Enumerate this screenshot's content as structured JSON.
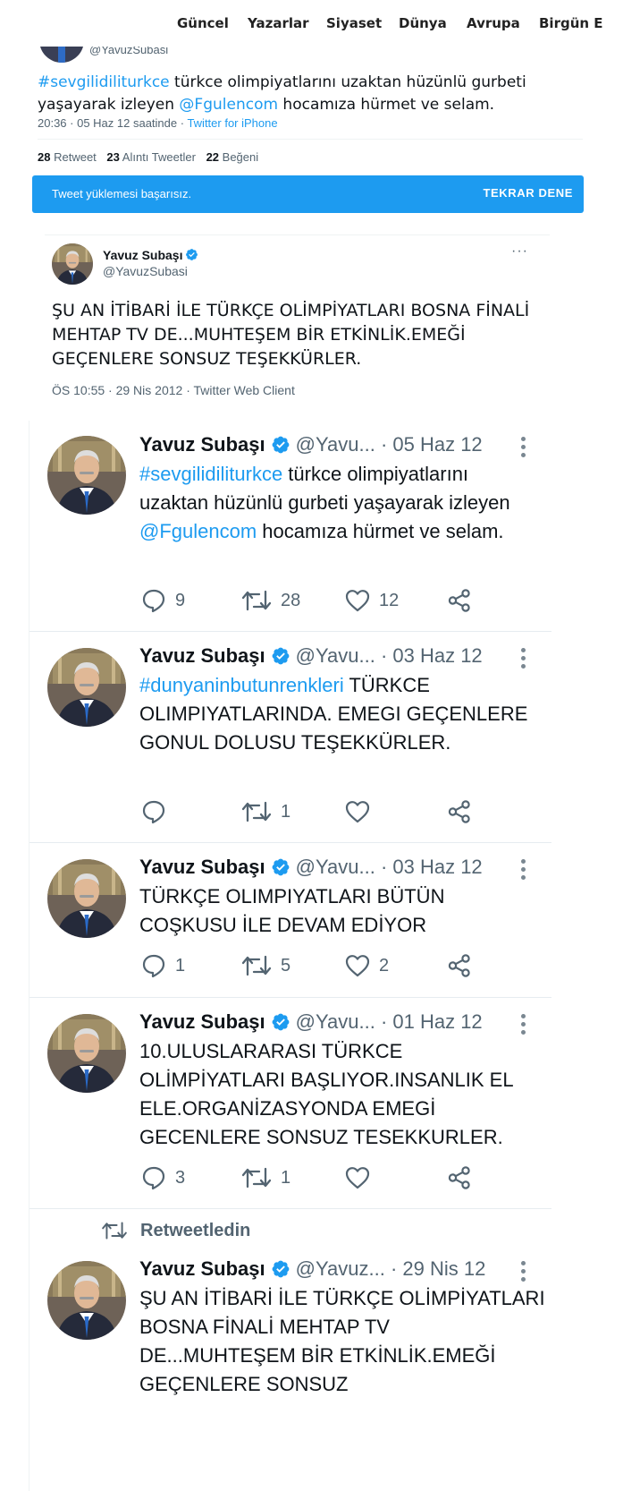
{
  "nav": {
    "items": [
      "Güncel",
      "Yazarlar",
      "Siyaset",
      "Dünya",
      "Avrupa",
      "Birgün E"
    ]
  },
  "embed1": {
    "handle": "@YavuzSubasi",
    "text": {
      "hashtag": "#sevgilidiliturkce",
      "part1": " türkce olimpiyatlarını uzaktan hüzünlü gurbeti yaşayarak izleyen ",
      "mention": "@Fgulencom",
      "part2": " hocamıza hürmet ve selam."
    },
    "meta_time": "20:36 · 05 Haz 12 saatinde · ",
    "meta_source": "Twitter for iPhone",
    "stats": {
      "retweets": "28",
      "retweets_label": "Retweet",
      "quotes": "23",
      "quotes_label": "Alıntı Tweetler",
      "likes": "22",
      "likes_label": "Beğeni"
    },
    "banner_message": "Tweet yüklemesi başarısız.",
    "banner_retry": "TEKRAR DENE"
  },
  "embed2": {
    "name": "Yavuz Subaşı",
    "handle": "@YavuzSubasi",
    "more": "···",
    "text": "ŞU AN İTİBARİ İLE TÜRKÇE OLİMPİYATLARI BOSNA FİNALİ MEHTAP TV DE...MUHTEŞEM BİR ETKİNLİK.EMEĞİ GEÇENLERE SONSUZ TEŞEKKÜRLER.",
    "meta": "ÖS 10:55 · 29 Nis 2012 · Twitter Web Client"
  },
  "feed": {
    "retweeted_label": "Retweetledin",
    "tweets": [
      {
        "name": "Yavuz Subaşı",
        "handle": "@Yavu...",
        "date": "· 05 Haz 12",
        "hashtag": "#sevgilidiliturkce",
        "text_a": " türkce olimpiyatlarını uzaktan hüzünlü gurbeti yaşayarak izleyen ",
        "mention": "@Fgulencom",
        "text_b": " hocamıza hürmet ve selam.",
        "replies": "9",
        "retweets": "28",
        "likes": "12"
      },
      {
        "name": "Yavuz Subaşı",
        "handle": "@Yavu...",
        "date": "· 03 Haz 12",
        "hashtag": "#dunyaninbutunrenkleri",
        "text_a": " TÜRKCE OLIMPIYATLARINDA. EMEGI GEÇENLERE GONUL DOLUSU TEŞEKKÜRLER.",
        "replies": "",
        "retweets": "1",
        "likes": ""
      },
      {
        "name": "Yavuz Subaşı",
        "handle": "@Yavu...",
        "date": "· 03 Haz 12",
        "text_a": "TÜRKÇE OLIMPIYATLARI BÜTÜN COŞKUSU İLE DEVAM EDİYOR",
        "replies": "1",
        "retweets": "5",
        "likes": "2"
      },
      {
        "name": "Yavuz Subaşı",
        "handle": "@Yavu...",
        "date": "· 01 Haz 12",
        "text_a": "10.ULUSLARARASI TÜRKCE OLİMPİYATLARI BAŞLIYOR.INSANLIK EL ELE.ORGANİZASYONDA EMEGİ GECENLERE SONSUZ TESEKKURLER.",
        "replies": "3",
        "retweets": "1",
        "likes": ""
      },
      {
        "name": "Yavuz Subaşı",
        "handle": "@Yavuz...",
        "date": "· 29 Nis 12",
        "text_a": "ŞU AN İTİBARİ İLE TÜRKÇE OLİMPİYATLARI BOSNA FİNALİ MEHTAP TV DE...MUHTEŞEM BİR ETKİNLİK.EMEĞİ GEÇENLERE SONSUZ"
      }
    ]
  },
  "colors": {
    "accent": "#1d9bf0",
    "text": "#0f1419",
    "muted": "#536471",
    "verified": "#1d9bf0"
  },
  "icons": {
    "verified": "verified-badge-icon",
    "reply": "reply-bubble-icon",
    "retweet": "retweet-arrows-icon",
    "like": "heart-icon",
    "share": "share-icon",
    "more": "vertical-dots-icon"
  }
}
